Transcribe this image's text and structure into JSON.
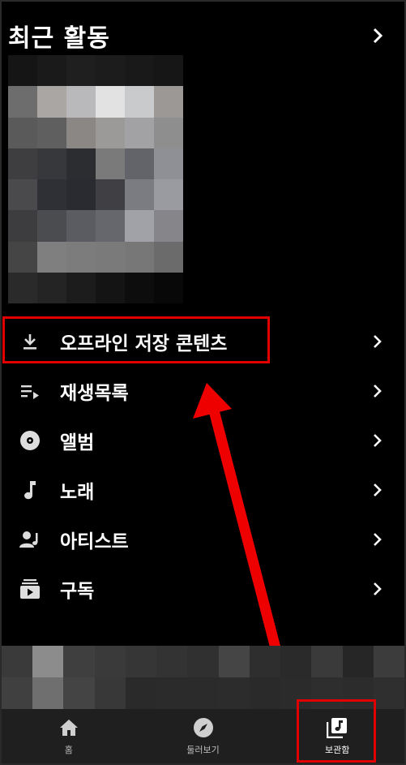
{
  "header": {
    "title": "최근 활동"
  },
  "menu": [
    {
      "label": "오프라인 저장 콘텐츠",
      "icon": "download-icon"
    },
    {
      "label": "재생목록",
      "icon": "playlist-icon"
    },
    {
      "label": "앨범",
      "icon": "album-icon"
    },
    {
      "label": "노래",
      "icon": "music-note-icon"
    },
    {
      "label": "아티스트",
      "icon": "artist-icon"
    },
    {
      "label": "구독",
      "icon": "subscriptions-icon"
    }
  ],
  "bottom_nav": [
    {
      "label": "홈",
      "icon": "home-icon",
      "active": false
    },
    {
      "label": "둘러보기",
      "icon": "explore-icon",
      "active": false
    },
    {
      "label": "보관함",
      "icon": "library-icon",
      "active": true
    }
  ],
  "colors": {
    "background": "#000000",
    "highlight": "#e10000",
    "nav_bg": "#1f1f1f"
  }
}
